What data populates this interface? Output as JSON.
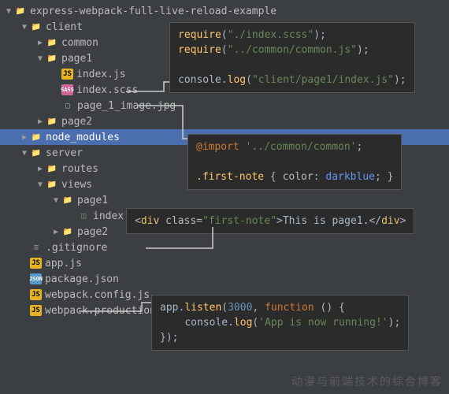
{
  "tree": {
    "root": "express-webpack-full-live-reload-example",
    "client": "client",
    "common": "common",
    "page1": "page1",
    "indexjs": "index.js",
    "indexscss": "index.scss",
    "page1img": "page_1_image.jpg",
    "page2": "page2",
    "nodemod": "node_modules",
    "server": "server",
    "routes": "routes",
    "views": "views",
    "vpage1": "page1",
    "indexhtml": "index.html",
    "vpage2": "page2",
    "gitignore": ".gitignore",
    "appjs": "app.js",
    "packagejson": "package.json",
    "webpackcfg": "webpack.config.js",
    "webpackprod": "webpack.production.config.js"
  },
  "code1": {
    "req": "require",
    "s1": "\"./index.scss\"",
    "s2": "\"../common/common.js\"",
    "log": "log",
    "s3": "\"client/page1/index.js\""
  },
  "code2": {
    "import": "@import",
    "s1": "'../common/common'",
    "sel": ".first-note",
    "prop": "color",
    "val": "darkblue"
  },
  "code3": {
    "tag": "div",
    "attr": "class",
    "val": "\"first-note\"",
    "txt": "This is page1."
  },
  "code4": {
    "listen": "listen",
    "port": "3000",
    "fn": "function",
    "log": "log",
    "msg": "'App is now running!'"
  },
  "watermark": "动漫与前端技术的综合博客"
}
